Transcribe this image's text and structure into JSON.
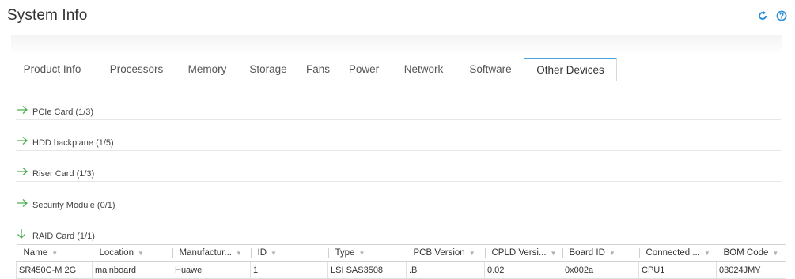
{
  "header": {
    "title": "System Info",
    "refresh_icon": "refresh-icon",
    "help_icon": "help-icon",
    "accent_color": "#4aa3df",
    "arrow_color": "#4caf50"
  },
  "tabs": [
    {
      "label": "Product Info",
      "active": false
    },
    {
      "label": "Processors",
      "active": false
    },
    {
      "label": "Memory",
      "active": false
    },
    {
      "label": "Storage",
      "active": false
    },
    {
      "label": "Fans",
      "active": false
    },
    {
      "label": "Power",
      "active": false
    },
    {
      "label": "Network",
      "active": false
    },
    {
      "label": "Software",
      "active": false
    },
    {
      "label": "Other Devices",
      "active": true
    }
  ],
  "sections": [
    {
      "label": "PCIe Card (1/3)",
      "expanded": false,
      "icon": "arrow-right-icon"
    },
    {
      "label": "HDD backplane (1/5)",
      "expanded": false,
      "icon": "arrow-right-icon"
    },
    {
      "label": "Riser Card (1/3)",
      "expanded": false,
      "icon": "arrow-right-icon"
    },
    {
      "label": "Security Module (0/1)",
      "expanded": false,
      "icon": "arrow-right-icon"
    },
    {
      "label": "RAID Card (1/1)",
      "expanded": true,
      "icon": "arrow-down-icon"
    }
  ],
  "raid_table": {
    "columns": [
      "Name",
      "Location",
      "Manufactur...",
      "ID",
      "Type",
      "PCB Version",
      "CPLD Versi...",
      "Board ID",
      "Connected ...",
      "BOM Code"
    ],
    "sort_icon": "sort-caret-icon",
    "rows": [
      [
        "SR450C-M 2G",
        "mainboard",
        "Huawei",
        "1",
        "LSI SAS3508",
        ".B",
        "0.02",
        "0x002a",
        "CPU1",
        "03024JMY"
      ]
    ]
  }
}
